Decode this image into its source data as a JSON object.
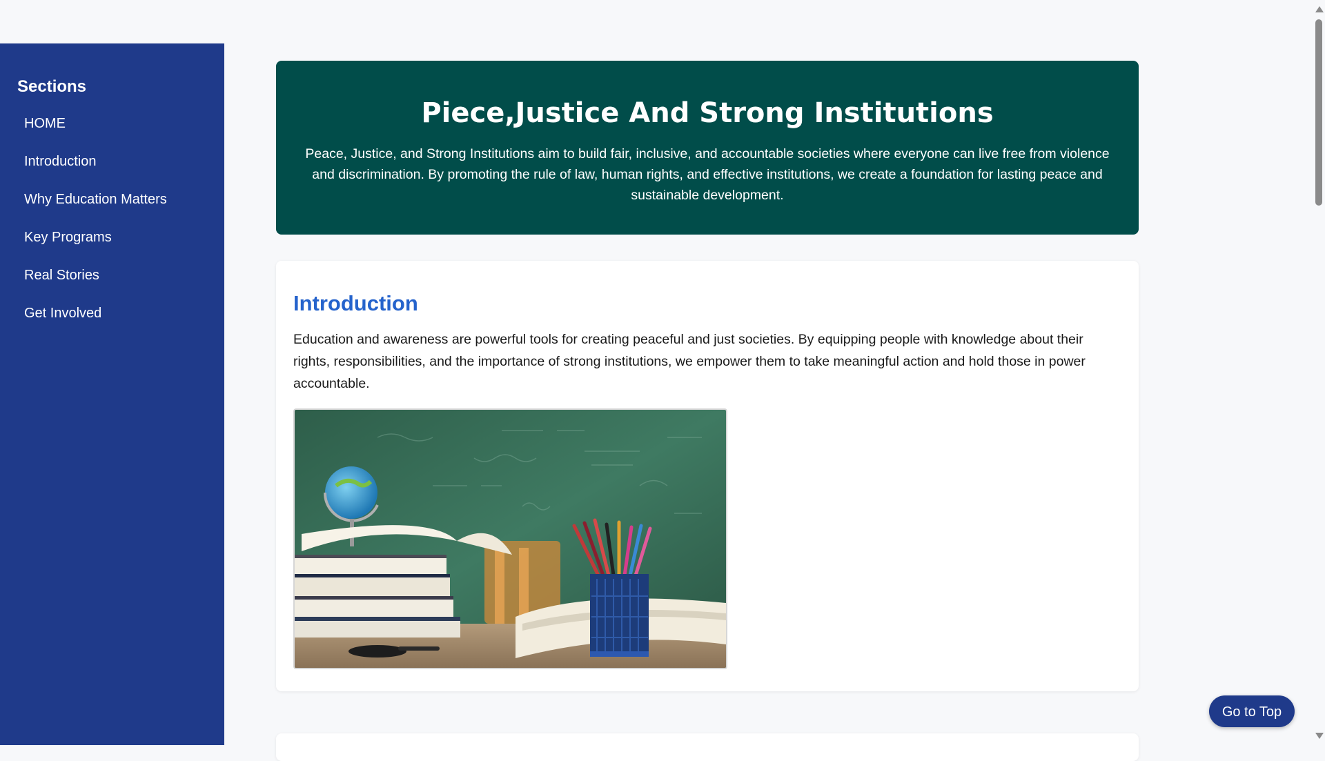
{
  "sidebar": {
    "title": "Sections",
    "items": [
      {
        "label": "HOME"
      },
      {
        "label": "Introduction"
      },
      {
        "label": "Why Education Matters"
      },
      {
        "label": "Key Programs"
      },
      {
        "label": "Real Stories"
      },
      {
        "label": "Get Involved"
      }
    ]
  },
  "hero": {
    "title": "Piece,Justice And Strong Institutions",
    "text": "Peace, Justice, and Strong Institutions aim to build fair, inclusive, and accountable societies where everyone can live free from violence and discrimination. By promoting the rule of law, human rights, and effective institutions, we create a foundation for lasting peace and sustainable development."
  },
  "introduction": {
    "heading": "Introduction",
    "text": "Education and awareness are powerful tools for creating peaceful and just societies. By equipping people with knowledge about their rights, responsibilities, and the importance of strong institutions, we empower them to take meaningful action and hold those in power accountable."
  },
  "goto_top": {
    "label": "Go to Top"
  },
  "colors": {
    "sidebar_bg": "#1f3a8a",
    "hero_bg": "#014d4a",
    "heading_accent": "#2563cc",
    "page_bg": "#f7f8fa"
  }
}
